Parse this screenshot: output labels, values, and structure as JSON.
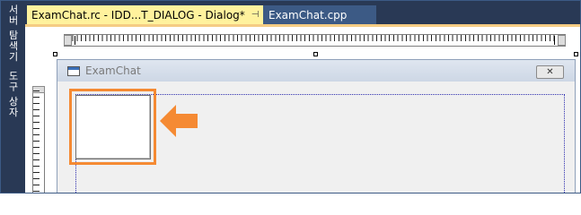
{
  "left_toolbox": {
    "tab1_label": "서버 탐색기",
    "tab2_label": "도구 상자"
  },
  "tabs": [
    {
      "label": "ExamChat.rc - IDD...T_DIALOG - Dialog*",
      "active": true,
      "pinned": true,
      "has_close": true
    },
    {
      "label": "ExamChat.cpp",
      "active": false
    }
  ],
  "tab_icons": {
    "pin": "⊣",
    "close": "✕"
  },
  "dialog": {
    "title": "ExamChat",
    "close_glyph": "✕",
    "app_icon": "window-icon"
  },
  "highlight": {
    "color": "#f58a33",
    "arrow_direction": "left",
    "arrow_icon": "arrow-left-icon"
  },
  "colors": {
    "ide_dark_blue": "#293955",
    "active_tab": "#fff29d",
    "inactive_tab": "#3c5a85",
    "tab_accent": "#f5cc84",
    "dialog_bg": "#f0f0f0"
  }
}
